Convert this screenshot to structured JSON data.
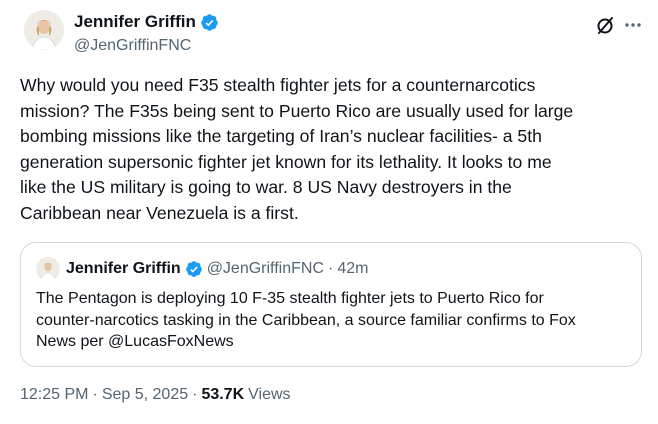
{
  "author": {
    "display_name": "Jennifer Griffin",
    "handle": "@JenGriffinFNC",
    "verified_color": "#1d9bf0"
  },
  "icons": {
    "grok": "grok-slash-circle-icon",
    "more": "more-horizontal-icon",
    "verified": "verified-badge-icon"
  },
  "tweet": {
    "text": "Why would you need F35 stealth fighter jets for a counternarcotics\nmission? The F35s being sent to Puerto Rico are usually used for large\nbombing missions like the targeting of Iran’s nuclear facilities- a 5th\ngeneration supersonic fighter jet known for its lethality. It looks to me\nlike the US military is going to war. 8 US Navy destroyers in the\nCaribbean near Venezuela is a first."
  },
  "quoted": {
    "display_name": "Jennifer Griffin",
    "handle": "@JenGriffinFNC",
    "separator": "·",
    "time": "42m",
    "text": "The Pentagon is deploying 10 F-35 stealth fighter jets to Puerto Rico for\ncounter-narcotics tasking in the Caribbean, a source familiar confirms to Fox\nNews per @LucasFoxNews"
  },
  "meta": {
    "time": "12:25 PM",
    "separator": "·",
    "date": "Sep 5, 2025",
    "separator2": "·",
    "views_count": "53.7K",
    "views_label": "Views"
  },
  "colors": {
    "text": "#0f1419",
    "secondary": "#536471",
    "border": "#cfd9de",
    "accent": "#1d9bf0"
  }
}
